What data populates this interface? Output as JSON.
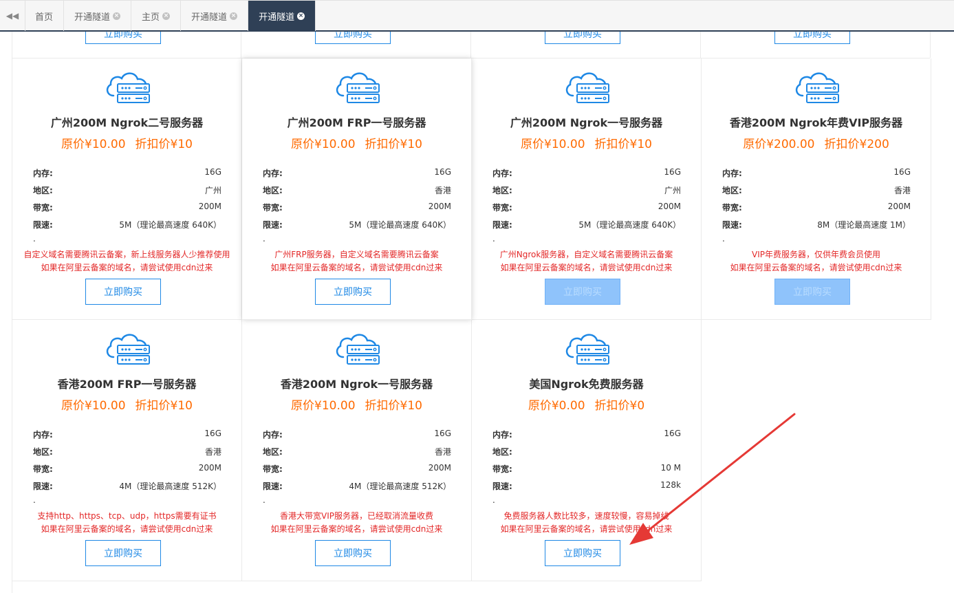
{
  "tabs": [
    {
      "label": "首页",
      "closable": false,
      "active": false
    },
    {
      "label": "开通隧道",
      "closable": true,
      "active": false
    },
    {
      "label": "主页",
      "closable": true,
      "active": false
    },
    {
      "label": "开通隧道",
      "closable": true,
      "active": false
    },
    {
      "label": "开通隧道",
      "closable": true,
      "active": true
    }
  ],
  "labels": {
    "memory": "内存:",
    "region": "地区:",
    "bandwidth": "带宽:",
    "speed": "限速:",
    "dot": ".",
    "buy": "立即购买"
  },
  "colors": {
    "accent": "#1e88e5",
    "price": "#ff6a00",
    "note": "#e32727",
    "tab_active": "#2f4056"
  },
  "cards": [
    {
      "title": "广州200M Ngrok二号服务器",
      "orig_price": "原价¥10.00",
      "disc_price": "折扣价¥10",
      "memory": "16G",
      "region": "广州",
      "bandwidth": "200M",
      "speed": "5M（理论最高速度 640K）",
      "note1": "自定义域名需要腾讯云备案，新上线服务器人少推荐使用",
      "note2": "如果在阿里云备案的域名，请尝试使用cdn过来",
      "buy_disabled": false
    },
    {
      "title": "广州200M FRP一号服务器",
      "orig_price": "原价¥10.00",
      "disc_price": "折扣价¥10",
      "memory": "16G",
      "region": "香港",
      "bandwidth": "200M",
      "speed": "5M（理论最高速度 640K）",
      "note1": "广州FRP服务器，自定义域名需要腾讯云备案",
      "note2": "如果在阿里云备案的域名，请尝试使用cdn过来",
      "buy_disabled": false
    },
    {
      "title": "广州200M Ngrok一号服务器",
      "orig_price": "原价¥10.00",
      "disc_price": "折扣价¥10",
      "memory": "16G",
      "region": "广州",
      "bandwidth": "200M",
      "speed": "5M（理论最高速度 640K）",
      "note1": "广州Ngrok服务器，自定义域名需要腾讯云备案",
      "note2": "如果在阿里云备案的域名，请尝试使用cdn过来",
      "buy_disabled": true
    },
    {
      "title": "香港200M Ngrok年费VIP服务器",
      "orig_price": "原价¥200.00",
      "disc_price": "折扣价¥200",
      "memory": "16G",
      "region": "香港",
      "bandwidth": "200M",
      "speed": "8M（理论最高速度 1M）",
      "note1": "VIP年费服务器，仅供年费会员使用",
      "note2": "如果在阿里云备案的域名，请尝试使用cdn过来",
      "buy_disabled": true
    },
    {
      "title": "香港200M FRP一号服务器",
      "orig_price": "原价¥10.00",
      "disc_price": "折扣价¥10",
      "memory": "16G",
      "region": "香港",
      "bandwidth": "200M",
      "speed": "4M（理论最高速度 512K）",
      "note1": "支持http、https、tcp、udp，https需要有证书",
      "note2": "如果在阿里云备案的域名，请尝试使用cdn过来",
      "buy_disabled": false
    },
    {
      "title": "香港200M Ngrok一号服务器",
      "orig_price": "原价¥10.00",
      "disc_price": "折扣价¥10",
      "memory": "16G",
      "region": "香港",
      "bandwidth": "200M",
      "speed": "4M（理论最高速度 512K）",
      "note1": "香港大带宽VIP服务器，已经取消流量收费",
      "note2": "如果在阿里云备案的域名，请尝试使用cdn过来",
      "buy_disabled": false
    },
    {
      "title": "美国Ngrok免费服务器",
      "orig_price": "原价¥0.00",
      "disc_price": "折扣价¥0",
      "memory": "16G",
      "region": "",
      "bandwidth": "10 M",
      "speed": "128k",
      "note1": "免费服务器人数比较多，速度较慢，容易掉线",
      "note2": "如果在阿里云备案的域名，请尝试使用cdn过来",
      "buy_disabled": false
    }
  ]
}
